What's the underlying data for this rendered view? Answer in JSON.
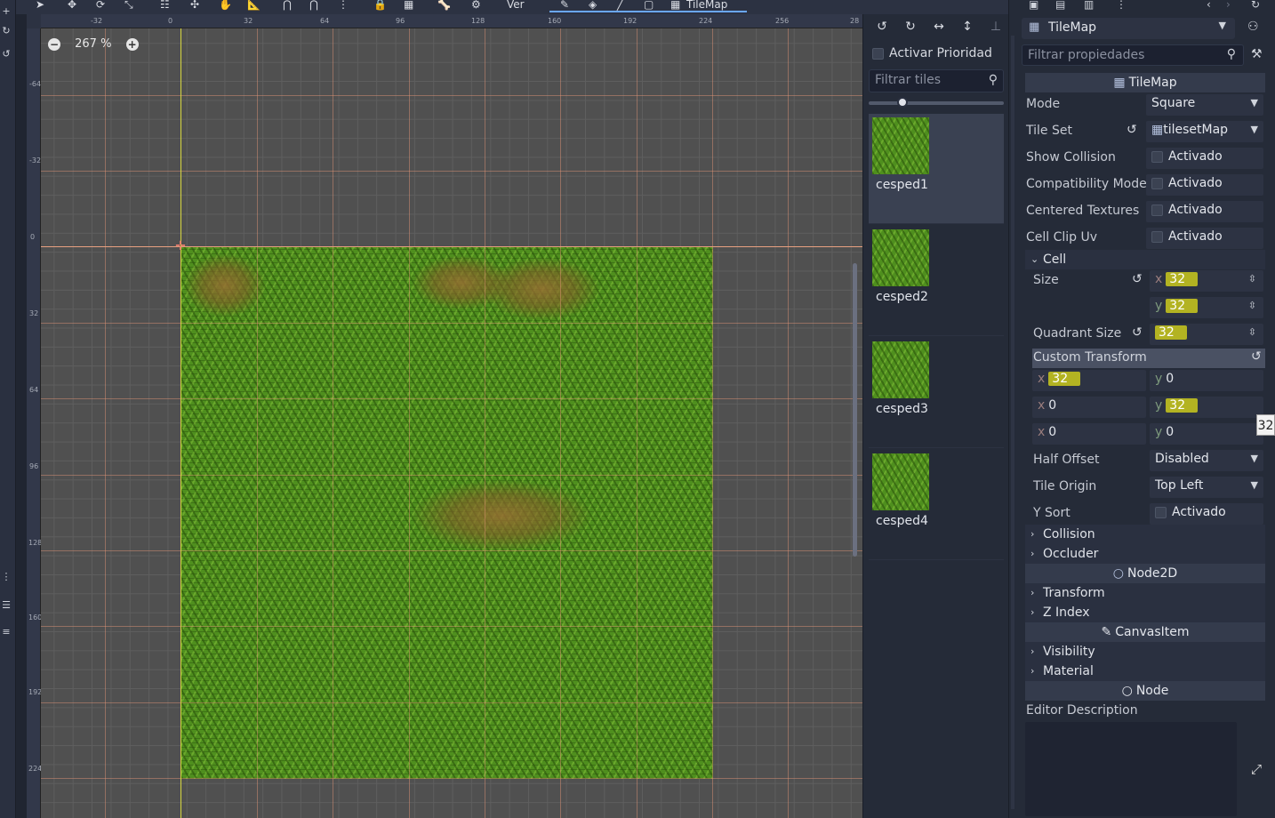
{
  "toolbar": {
    "view_label": "Ver",
    "tilemap_tab": "TileMap"
  },
  "viewport": {
    "zoom": "267 %",
    "hruler_ticks": [
      "-32",
      "0",
      "32",
      "64",
      "96",
      "128",
      "160",
      "192",
      "224",
      "256",
      "28"
    ],
    "vruler_ticks": [
      "-64",
      "-32",
      "0",
      "32",
      "64",
      "96",
      "128",
      "160",
      "192",
      "224"
    ]
  },
  "palette": {
    "priority_label": "Activar Prioridad",
    "filter_placeholder": "Filtrar tiles",
    "zoom_slider": 0.25,
    "tiles": [
      {
        "name": "cesped1",
        "selected": true
      },
      {
        "name": "cesped2",
        "selected": false
      },
      {
        "name": "cesped3",
        "selected": false
      },
      {
        "name": "cesped4",
        "selected": false
      }
    ]
  },
  "inspector": {
    "node_name": "TileMap",
    "filter_placeholder": "Filtrar propiedades",
    "section_tilemap": "TileMap",
    "mode_label": "Mode",
    "mode_value": "Square",
    "tileset_label": "Tile Set",
    "tileset_value": "tilesetMap",
    "show_collision_label": "Show Collision",
    "compat_label": "Compatibility Mode",
    "centered_label": "Centered Textures",
    "clipuv_label": "Cell Clip Uv",
    "activado": "Activado",
    "cell_group": "Cell",
    "size_label": "Size",
    "size_x": "32",
    "size_y": "32",
    "quadrant_label": "Quadrant Size",
    "quadrant_value": "32",
    "custom_transform_label": "Custom Transform",
    "transform": {
      "r1x": "32",
      "r1y": "0",
      "r2x": "0",
      "r2y": "32",
      "r3x": "0",
      "r3y": "0"
    },
    "axis_x": "x",
    "axis_y": "y",
    "half_offset_label": "Half Offset",
    "half_offset_value": "Disabled",
    "tile_origin_label": "Tile Origin",
    "tile_origin_value": "Top Left",
    "ysort_label": "Y Sort",
    "collision_group": "Collision",
    "occluder_group": "Occluder",
    "section_node2d": "Node2D",
    "transform_group": "Transform",
    "zindex_group": "Z Index",
    "section_canvasitem": "CanvasItem",
    "visibility_group": "Visibility",
    "material_group": "Material",
    "section_node": "Node",
    "editor_desc_label": "Editor Description",
    "tooltip_value": "32"
  },
  "colors": {
    "highlight": "#b3b322",
    "accent": "#6aa7ff"
  }
}
